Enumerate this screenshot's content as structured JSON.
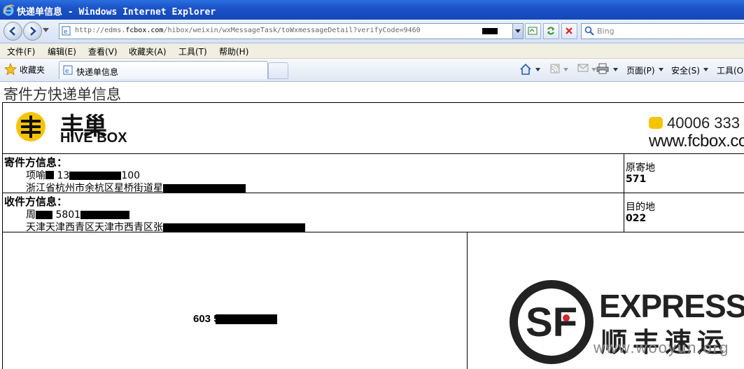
{
  "window": {
    "title": "快递单信息 - Windows Internet Explorer"
  },
  "address_bar": {
    "url_prefix": "http://edms.",
    "url_host": "fcbox.com",
    "url_rest": "/hibox/weixin/wxMessageTask/toWxmessageDetail?verifyCode=9460"
  },
  "search": {
    "placeholder": "Bing"
  },
  "menu": {
    "file": "文件(F)",
    "edit": "编辑(E)",
    "view": "查看(V)",
    "favorites": "收藏夹(A)",
    "tools": "工具(T)",
    "help": "帮助(H)"
  },
  "favbar": {
    "favorites_label": "收藏夹",
    "tab_label": "快递单信息",
    "page_label": "页面(P)",
    "safety_label": "安全(S)",
    "tools_label": "工具(O)"
  },
  "page": {
    "title": "寄件方快递单信息",
    "header": {
      "brand_cn": "丰巢",
      "brand_en": "HIVE BOX",
      "hotline": "40006 333",
      "site": "www.fcbox.com"
    },
    "sender": {
      "heading": "寄件方信息：",
      "name_prefix": "项喻",
      "phone_prefix": "13",
      "phone_suffix": "100",
      "address_prefix": "浙江省杭州市余杭区星桥街道星",
      "origin_label": "原寄地",
      "origin_code": "571"
    },
    "receiver": {
      "heading": "收件方信息：",
      "name_prefix": "周",
      "phone_prefix": "5801",
      "address_prefix": "天津天津西青区天津市西青区张",
      "dest_label": "目的地",
      "dest_code": "022"
    },
    "waybill": {
      "number_prefix": "603 5"
    },
    "sf": {
      "letters": "SF",
      "express": "EXPRESS",
      "cn": "顺丰速运"
    },
    "watermark": "www.wooyun.org"
  },
  "colors": {
    "titlebar": "#1c52c8",
    "menubar": "#f1efe2",
    "hivebox_yellow": "#f5c400",
    "sf_dark": "#222222"
  }
}
